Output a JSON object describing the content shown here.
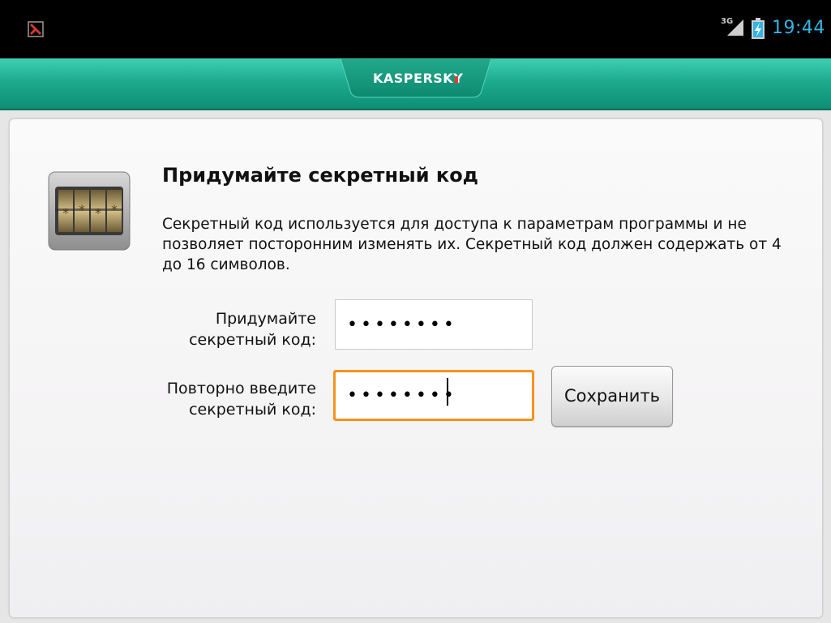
{
  "status_bar": {
    "network": "3G",
    "clock": "19:44",
    "notification_icon": "kaspersky-notification-icon",
    "battery_icon": "battery-charging-icon"
  },
  "header": {
    "logo_text": "KASPERSKY",
    "colors": {
      "header": "#1eab8e",
      "accent_orange": "#f7921e",
      "clock": "#33b5e5"
    }
  },
  "main": {
    "icon": "combination-lock-icon",
    "title": "Придумайте секретный код",
    "description": "Секретный код используется для доступа к параметрам программы и не позволяет посторонним изменять их. Секретный код должен содержать от 4 до 16 символов.",
    "field1": {
      "label_line1": "Придумайте",
      "label_line2": "секретный код:",
      "value": "••••••••"
    },
    "field2": {
      "label_line1": "Повторно введите",
      "label_line2": "секретный код:",
      "value": "••••••••"
    },
    "save_label": "Сохранить"
  }
}
